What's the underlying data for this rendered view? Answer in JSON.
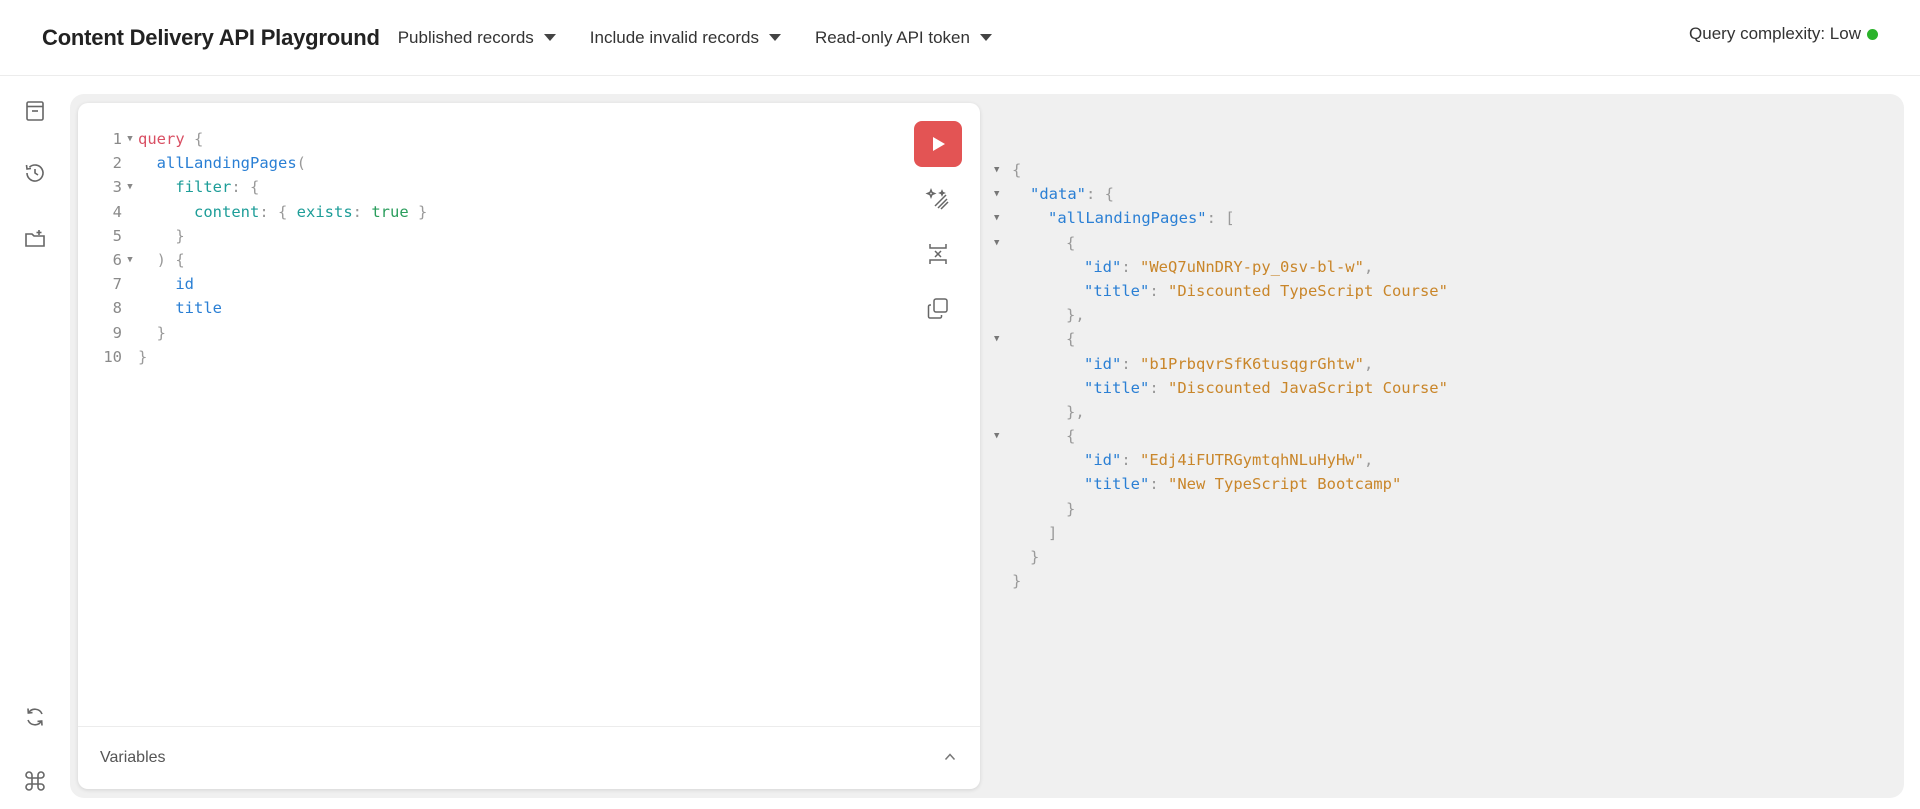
{
  "header": {
    "title": "Content Delivery API Playground",
    "dropdowns": [
      {
        "label": "Published records"
      },
      {
        "label": "Include invalid records"
      },
      {
        "label": "Read-only API token"
      }
    ],
    "complexity_label": "Query complexity: Low",
    "complexity_status_color": "#2bb32b"
  },
  "sidebar": {
    "top_icons": [
      "document-icon",
      "history-icon",
      "folder-add-icon"
    ],
    "bottom_icons": [
      "refresh-icon",
      "command-icon"
    ]
  },
  "editor": {
    "lines": [
      {
        "n": "1",
        "fold": true
      },
      {
        "n": "2",
        "fold": false
      },
      {
        "n": "3",
        "fold": true
      },
      {
        "n": "4",
        "fold": false
      },
      {
        "n": "5",
        "fold": false
      },
      {
        "n": "6",
        "fold": true
      },
      {
        "n": "7",
        "fold": false
      },
      {
        "n": "8",
        "fold": false
      },
      {
        "n": "9",
        "fold": false
      },
      {
        "n": "10",
        "fold": false
      }
    ],
    "tokens": {
      "query": "query",
      "allLandingPages": "allLandingPages",
      "filter": "filter",
      "content": "content",
      "exists": "exists",
      "true": "true",
      "id": "id",
      "title": "title"
    },
    "toolbar": [
      "run-button",
      "prettify-button",
      "merge-fragments-button",
      "copy-button"
    ],
    "variables_label": "Variables"
  },
  "result": {
    "data_key": "\"data\"",
    "list_key": "\"allLandingPages\"",
    "id_key": "\"id\"",
    "title_key": "\"title\"",
    "records": [
      {
        "id": "\"WeQ7uNnDRY-py_0sv-bl-w\"",
        "title": "\"Discounted TypeScript Course\""
      },
      {
        "id": "\"b1PrbqvrSfK6tusqgrGhtw\"",
        "title": "\"Discounted JavaScript Course\""
      },
      {
        "id": "\"Edj4iFUTRGymtqhNLuHyHw\"",
        "title": "\"New TypeScript Bootcamp\""
      }
    ]
  },
  "colors": {
    "run_button": "#e35454",
    "keyword": "#d94f63",
    "field": "#2a7fd4",
    "string": "#c9862a"
  }
}
